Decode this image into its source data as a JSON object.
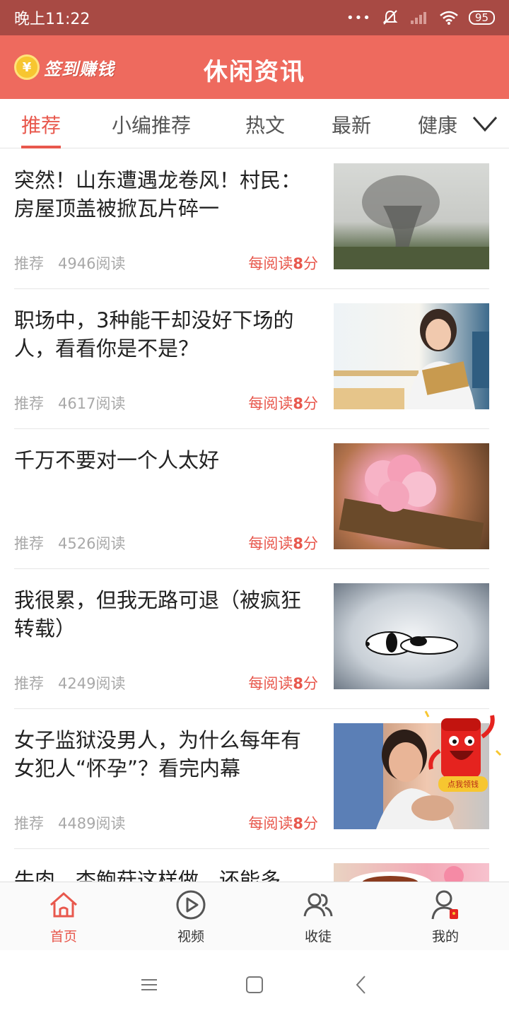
{
  "status_bar": {
    "time": "晚上11:22",
    "dots": "•••",
    "battery": "95"
  },
  "header": {
    "checkin_label": "签到赚钱",
    "coin_symbol": "¥",
    "title": "休闲资讯"
  },
  "tabs": [
    {
      "label": "推荐",
      "active": true
    },
    {
      "label": "小编推荐"
    },
    {
      "label": "热文"
    },
    {
      "label": "最新"
    },
    {
      "label": "健康"
    }
  ],
  "articles": [
    {
      "title": "突然！山东遭遇龙卷风！村民：房屋顶盖被掀瓦片碎一",
      "tag": "推荐",
      "reads": "4946阅读",
      "reward_prefix": "每阅读",
      "reward_value": "8",
      "reward_suffix": "分"
    },
    {
      "title": "职场中，3种能干却没好下场的人，看看你是不是？",
      "tag": "推荐",
      "reads": "4617阅读",
      "reward_prefix": "每阅读",
      "reward_value": "8",
      "reward_suffix": "分"
    },
    {
      "title": "千万不要对一个人太好",
      "tag": "推荐",
      "reads": "4526阅读",
      "reward_prefix": "每阅读",
      "reward_value": "8",
      "reward_suffix": "分"
    },
    {
      "title": "我很累，但我无路可退（被疯狂转载）",
      "tag": "推荐",
      "reads": "4249阅读",
      "reward_prefix": "每阅读",
      "reward_value": "8",
      "reward_suffix": "分"
    },
    {
      "title": "女子监狱没男人，为什么每年有女犯人“怀孕”？看完内幕",
      "tag": "推荐",
      "reads": "4489阅读",
      "reward_prefix": "每阅读",
      "reward_value": "8",
      "reward_suffix": "分"
    },
    {
      "title": "牛肉、杏鲍菇这样做，还能多"
    }
  ],
  "red_packet": {
    "label": "点我领钱"
  },
  "bottom_nav": [
    {
      "label": "首页",
      "active": true
    },
    {
      "label": "视频"
    },
    {
      "label": "收徒"
    },
    {
      "label": "我的"
    }
  ],
  "colors": {
    "status_bar": "#a84a44",
    "header": "#ee6a5e",
    "accent": "#e8584d"
  }
}
